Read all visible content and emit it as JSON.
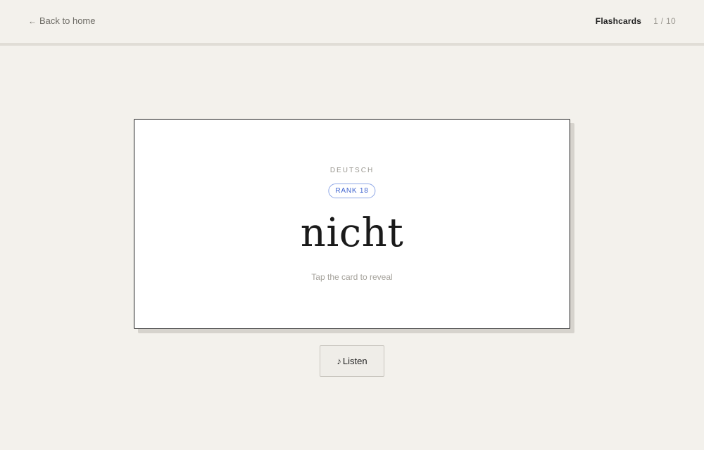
{
  "header": {
    "back_icon": "arrow-left-icon",
    "back_arrow": "←",
    "back_label": "Back to home",
    "section_title": "Flashcards",
    "progress": "1 / 10"
  },
  "card": {
    "language": "DEUTSCH",
    "rank_badge": "RANK 18",
    "word": "nicht",
    "hint": "Tap the card to reveal"
  },
  "listen_button": {
    "icon": "music-note-icon",
    "icon_glyph": "♪",
    "label": "Listen"
  },
  "colors": {
    "background": "#f3f1ec",
    "card_background": "#ffffff",
    "card_border": "#1f1f1f",
    "badge_accent": "#3f63cf",
    "muted_text": "#9b9891"
  }
}
